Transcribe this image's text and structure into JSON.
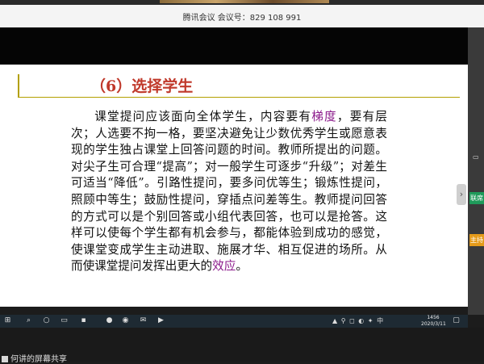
{
  "meeting": {
    "info": "腾讯会议  会议号：829 108 991"
  },
  "slide": {
    "title": "（6）选择学生",
    "paragraph": [
      {
        "t": "课堂提问应该面向全体学生，内容要有"
      },
      {
        "t": "梯度",
        "hl": true
      },
      {
        "t": "，要有层次；人选要不拘一格，要坚决避免让少数优秀学生或愿意表现的学生独占课堂上回答问题的时间。教师所提出的问题。对尖子生可合理“提高”；对一般学生可逐步“升级”；对差生可适当“降低”。引路性提问，要多问优等生；锻炼性提问，照顾中等生；鼓励性提问，穿插点问差等生。教师提问回答的方式可以是个别回答或小组代表回答，也可以是抢答。这样可以使每个学生都有机会参与，都能体验到成功的感觉，使课堂变成学生主动进取、施展才华、相互促进的场所。从而使课堂提问发挥出更大的"
      },
      {
        "t": "效应",
        "hl": true
      },
      {
        "t": "。"
      }
    ],
    "highlight_color": "#8b1a8b",
    "title_color": "#c0392b"
  },
  "side_panel": {
    "green_label": "联席",
    "orange_label": "主持"
  },
  "taskbar": {
    "time": "1456",
    "date": "2020/3/11",
    "tray_lang": "中",
    "icons": [
      "windows-start-icon",
      "search-icon",
      "cortana-icon",
      "task-view-icon",
      "app-icon",
      "app-icon",
      "browser-icon",
      "mail-icon",
      "cloud-icon",
      "video-icon"
    ]
  },
  "bottom": {
    "share_label": "何讲的屏幕共享"
  }
}
